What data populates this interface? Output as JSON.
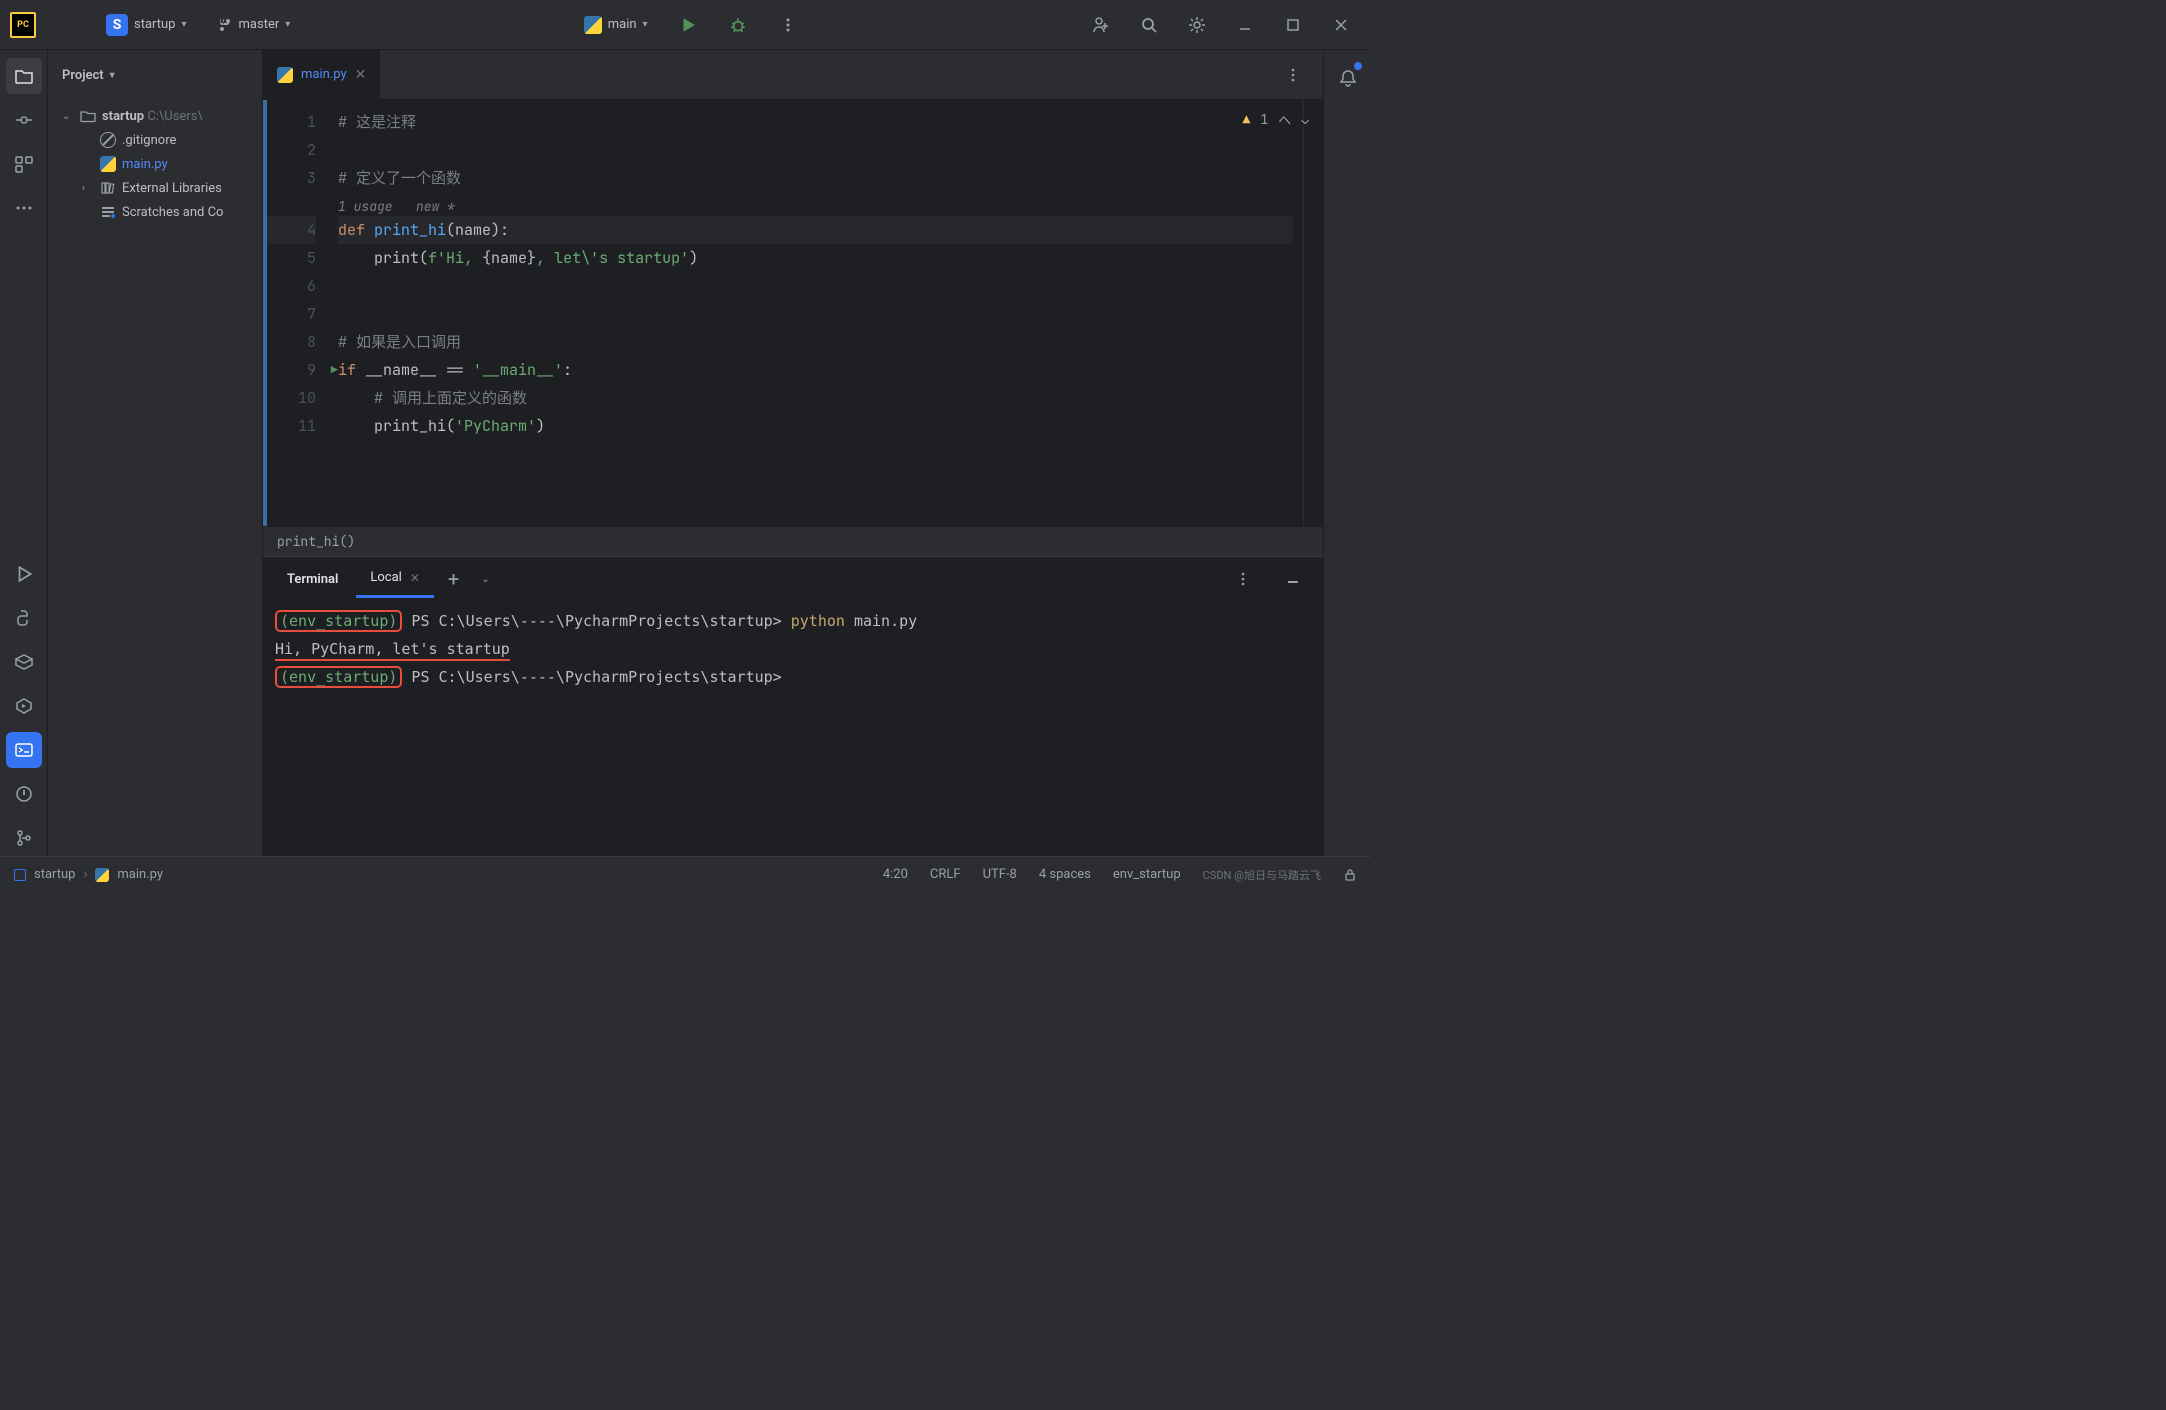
{
  "titlebar": {
    "project_letter": "S",
    "project_name": "startup",
    "branch_name": "master",
    "run_config": "main"
  },
  "project_panel": {
    "title": "Project",
    "tree": {
      "root": "startup",
      "root_path": "C:\\Users\\",
      "gitignore": ".gitignore",
      "main_py": "main.py",
      "external_libs": "External Libraries",
      "scratches": "Scratches and Co"
    }
  },
  "editor": {
    "tab_name": "main.py",
    "warnings": "1",
    "inlay": "1 usage   new *",
    "lines": [
      "# 这是注释",
      "",
      "# 定义了一个函数",
      "",
      "def print_hi(name):",
      "    print(f'Hi, {name}, let\\'s startup')",
      "",
      "",
      "# 如果是入口调用",
      "if __name__ == '__main__':",
      "    # 调用上面定义的函数",
      "    print_hi('PyCharm')"
    ],
    "breadcrumb": "print_hi()"
  },
  "terminal": {
    "tab1": "Terminal",
    "tab2": "Local",
    "env": "(env_startup)",
    "prompt_path": " PS C:\\Users\\----\\PycharmProjects\\startup> ",
    "prompt_path2": " PS C:\\Users\\----\\PycharmProjects\\startup>",
    "command": "python main.py",
    "cmd_py": "python",
    "cmd_arg": " main.py",
    "output": "Hi, PyCharm, let's startup"
  },
  "statusbar": {
    "project": "startup",
    "file": "main.py",
    "cursor": "4:20",
    "line_sep": "CRLF",
    "encoding": "UTF-8",
    "indent": "4 spaces",
    "interpreter": "env_startup",
    "watermark": "CSDN @旭日与马踏云飞"
  }
}
